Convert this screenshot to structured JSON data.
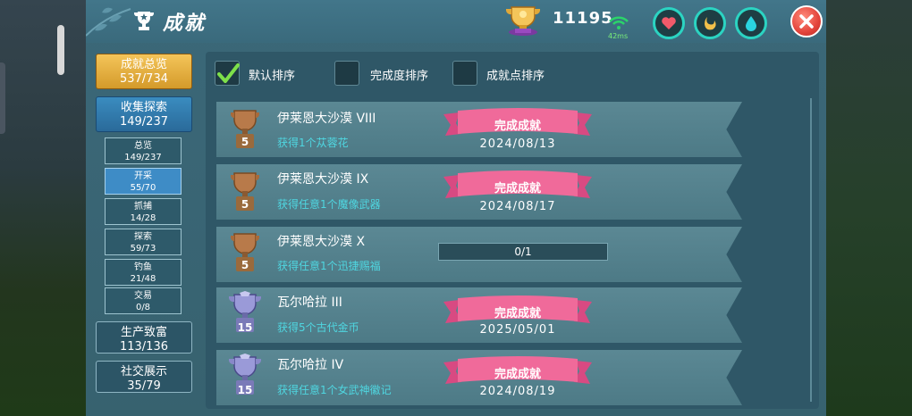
{
  "window": {
    "title": "成就"
  },
  "hud": {
    "points": "11195",
    "ping": "42ms",
    "icons": [
      "trophy-icon",
      "wifi-icon",
      "heart-icon",
      "stomach-icon",
      "water-drop-icon",
      "close-icon"
    ]
  },
  "categories": {
    "groups": [
      {
        "label": "成就总览",
        "count": "537/734"
      },
      {
        "label": "收集探索",
        "count": "149/237"
      },
      {
        "label": "生产致富",
        "count": "113/136"
      },
      {
        "label": "社交展示",
        "count": "35/79"
      }
    ],
    "subitems": [
      {
        "label": "总览",
        "count": "149/237"
      },
      {
        "label": "开采",
        "count": "55/70"
      },
      {
        "label": "抓捕",
        "count": "14/28"
      },
      {
        "label": "探索",
        "count": "59/73"
      },
      {
        "label": "钓鱼",
        "count": "21/48"
      },
      {
        "label": "交易",
        "count": "0/8"
      }
    ]
  },
  "sort": {
    "options": [
      "默认排序",
      "完成度排序",
      "成就点排序"
    ],
    "checked": [
      true,
      false,
      false
    ]
  },
  "achievements": [
    {
      "name": "伊莱恩大沙漠 VIII",
      "desc": "获得1个苁蓉花",
      "badge": "5",
      "status": "完成成就",
      "date": "2024/08/13"
    },
    {
      "name": "伊莱恩大沙漠 IX",
      "desc": "获得任意1个魔像武器",
      "badge": "5",
      "status": "完成成就",
      "date": "2024/08/17"
    },
    {
      "name": "伊莱恩大沙漠 X",
      "desc": "获得任意1个迅捷赐福",
      "badge": "5",
      "progress": "0/1",
      "progress_value": 0
    },
    {
      "name": "瓦尔哈拉 III",
      "desc": "获得5个古代金币",
      "badge": "15",
      "status": "完成成就",
      "date": "2025/05/01"
    },
    {
      "name": "瓦尔哈拉 IV",
      "desc": "获得任意1个女武神徽记",
      "badge": "15",
      "status": "完成成就",
      "date": "2024/08/19"
    }
  ],
  "colors": {
    "accent": "#4fd6e0",
    "gold": "#f4c55a",
    "ribbon": "#f06a9a",
    "close": "#e3443b"
  }
}
